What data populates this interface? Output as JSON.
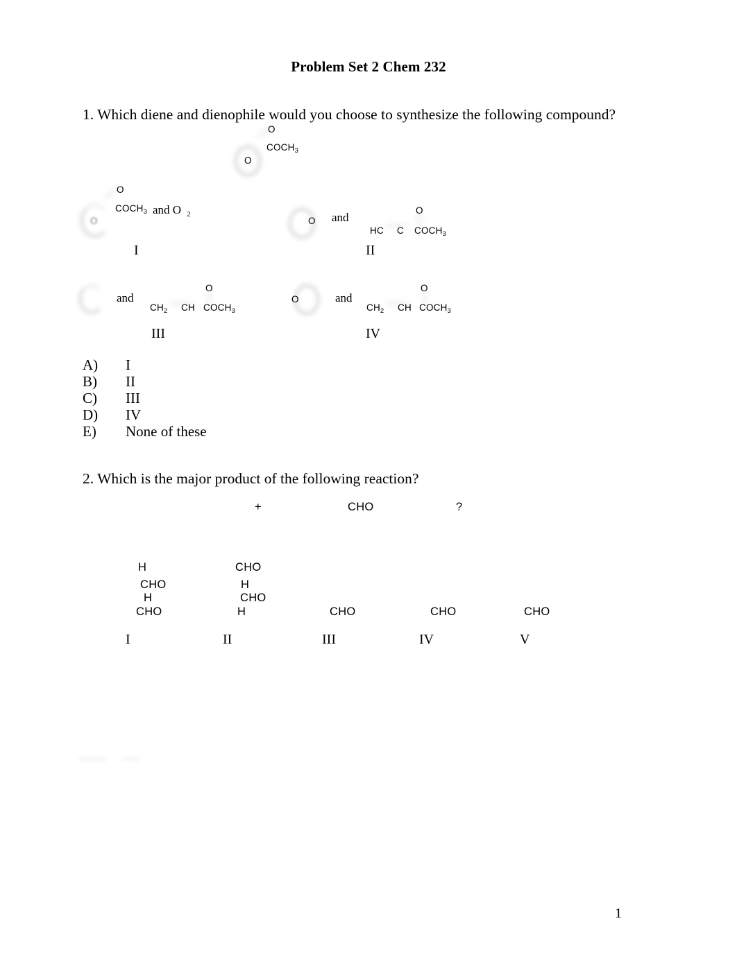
{
  "document": {
    "title": "Problem Set 2 Chem 232",
    "page_number": "1"
  },
  "question1": {
    "stem": "1. Which diene and dienophile would you choose to synthesize the following compound?",
    "target_compound": {
      "o_top": "O",
      "coch3": "COCH",
      "coch3_sub": "3",
      "o_ring": "O"
    },
    "options": [
      {
        "label": "I",
        "o_top": "O",
        "coch3": "COCH",
        "coch3_sub": "3",
        "connector": "and O",
        "connector_sub": "2",
        "ring_o": "O"
      },
      {
        "label": "II",
        "ring_o": "O",
        "connector": "and",
        "o_top": "O",
        "chain_left": "HC",
        "chain_mid": "C",
        "chain_right": "COCH",
        "chain_right_sub": "3"
      },
      {
        "label": "III",
        "connector": "and",
        "o_top": "O",
        "chain_left": "CH",
        "chain_left_sub": "2",
        "chain_mid": "CH",
        "chain_right": "COCH",
        "chain_right_sub": "3"
      },
      {
        "label": "IV",
        "ring_o": "O",
        "connector": "and",
        "o_top": "O",
        "chain_left": "CH",
        "chain_left_sub": "2",
        "chain_mid": "CH",
        "chain_right": "COCH",
        "chain_right_sub": "3"
      }
    ],
    "answers": [
      {
        "key": "A)",
        "value": "I"
      },
      {
        "key": "B)",
        "value": "II"
      },
      {
        "key": "C)",
        "value": "III"
      },
      {
        "key": "D)",
        "value": "IV"
      },
      {
        "key": "E)",
        "value": "None of these"
      }
    ]
  },
  "question2": {
    "stem": "2. Which is the major product of the following reaction?",
    "reaction": {
      "plus": "+",
      "reagent": "CHO",
      "question_mark": "?"
    },
    "options": [
      {
        "label": "I",
        "lines": [
          "H",
          "CHO",
          "H",
          "CHO"
        ]
      },
      {
        "label": "II",
        "lines": [
          "CHO",
          "H",
          "CHO",
          "H"
        ]
      },
      {
        "label": "III",
        "lines": [
          "CHO"
        ]
      },
      {
        "label": "IV",
        "lines": [
          "CHO"
        ]
      },
      {
        "label": "V",
        "lines": [
          "CHO"
        ]
      }
    ]
  }
}
